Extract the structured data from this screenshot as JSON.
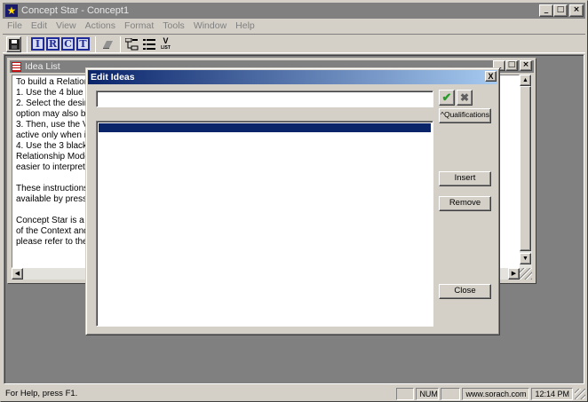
{
  "app": {
    "title": "Concept Star - Concept1",
    "icon": "star-icon"
  },
  "menu": [
    "File",
    "Edit",
    "View",
    "Actions",
    "Format",
    "Tools",
    "Window",
    "Help"
  ],
  "toolbar": {
    "letters": [
      "I",
      "R",
      "C",
      "T"
    ],
    "list_label": "LIST"
  },
  "idea_window": {
    "title": "Idea List",
    "lines": [
      "To build a Relation",
      "1. Use the 4 blue t",
      "2. Select the desir",
      "option may also be",
      "3. Then, use the V",
      "active only when ic",
      "4. Use the 3 black",
      "Relationship Mode",
      "easier to interpret."
    ],
    "lines2": [
      "These instructions",
      "available by pressi"
    ],
    "lines3": [
      "Concept Star is a",
      "of the Context and",
      "please refer to the"
    ]
  },
  "dialog": {
    "title": "Edit Ideas",
    "close_glyph": "X",
    "input_value": "",
    "qualifications_label": "^Qualifications",
    "insert_label": "Insert",
    "remove_label": "Remove",
    "close_label": "Close"
  },
  "status": {
    "hint": "For Help, press F1.",
    "num": "NUM",
    "website": "www.sorach.com",
    "time": "12:14 PM"
  },
  "colors": {
    "dialog_title_start": "#0a246a",
    "selection": "#0a246a",
    "toolbar_letter": "#1f2b99"
  }
}
